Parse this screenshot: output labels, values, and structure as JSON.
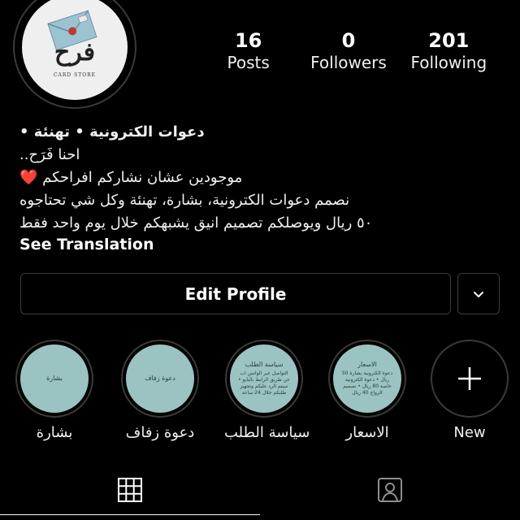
{
  "profile": {
    "avatar_icon": "envelope-logo-icon",
    "avatar_text": "فرح",
    "avatar_subtext": "CARD STORE",
    "stats": [
      {
        "value": "16",
        "label": "Posts"
      },
      {
        "value": "0",
        "label": "Followers"
      },
      {
        "value": "201",
        "label": "Following"
      }
    ],
    "bio": {
      "name": "دعوات الكترونية • تهنئة •",
      "lines": [
        "احنا فَرَح..",
        "موجودين عشان نشاركم افراحكم ❤️",
        "نصمم دعوات الكترونية، بشارة، تهنئة وكل شي تحتاجوه",
        "٥٠ ريال ويوصلكم تصميم انيق يشبهكم خلال يوم واحد فقط"
      ],
      "see_translation": "See Translation"
    },
    "edit_profile": "Edit Profile",
    "more_icon": "chevron-down-icon"
  },
  "highlights": [
    {
      "label": "بشارة",
      "cover_text": "بشارة"
    },
    {
      "label": "دعوة زفاف",
      "cover_text": "دعوة زفاف"
    },
    {
      "label": "سياسة الطلب",
      "cover_title": "سياسة الطلب",
      "cover_text": "التواصل عبر الواتس اب عن طريق الرابط بالبايو • سيتم الرد عليكم وتجهيز طلبكم خلال 24 ساعة"
    },
    {
      "label": "الاسعار",
      "cover_title": "الاسعار",
      "cover_text": "دعوة الكترونية بشارة 50 ريال • دعوة الكترونية خاصة 80 ريال • تصميم الزواج 40 ريال"
    },
    {
      "label": "New",
      "icon": "plus-icon"
    }
  ],
  "tabs": [
    {
      "name": "grid",
      "icon": "grid-icon",
      "active": true
    },
    {
      "name": "tagged",
      "icon": "tagged-person-icon",
      "active": false
    }
  ],
  "colors": {
    "background": "#000000",
    "highlight_cover": "#9ac3c1",
    "border": "#3a3a3a"
  }
}
